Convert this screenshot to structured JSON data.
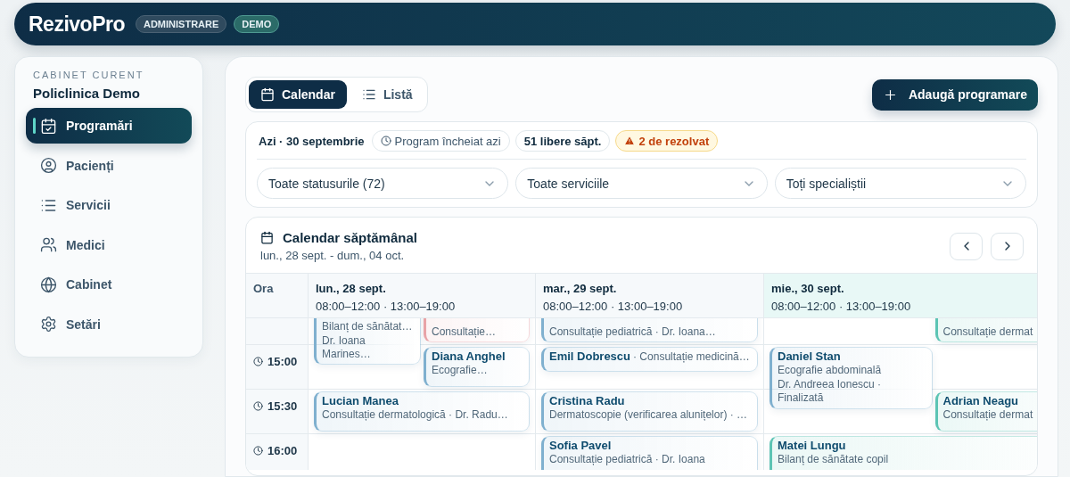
{
  "header": {
    "logo": "RezivoPro",
    "badges": [
      {
        "label": "ADMINISTRARE",
        "kind": "role"
      },
      {
        "label": "DEMO",
        "kind": "env"
      }
    ]
  },
  "sidebar": {
    "caption": "CABINET CURENT",
    "clinic": "Policlinica Demo",
    "items": [
      {
        "label": "Programări",
        "selected": true
      },
      {
        "label": "Pacienți",
        "selected": false
      },
      {
        "label": "Servicii",
        "selected": false
      },
      {
        "label": "Medici",
        "selected": false
      },
      {
        "label": "Cabinet",
        "selected": false
      },
      {
        "label": "Setări",
        "selected": false
      }
    ]
  },
  "view_toggle": [
    {
      "label": "Calendar",
      "selected": true
    },
    {
      "label": "Listă",
      "selected": false
    }
  ],
  "add_button": "Adaugă programare",
  "summary": {
    "today": "Azi · 30 septembrie",
    "chips": [
      {
        "label": "Program încheiat azi",
        "kind": "status"
      },
      {
        "label": "51 libere săpt.",
        "kind": "plain"
      },
      {
        "label": "2 de rezolvat",
        "kind": "warning"
      }
    ]
  },
  "filters": [
    {
      "value": "Toate statusurile (72)"
    },
    {
      "value": "Toate serviciile"
    },
    {
      "value": "Toți specialiștii"
    }
  ],
  "calendar": {
    "title": "Calendar săptămânal",
    "range": "lun., 28 sept. - dum., 04 oct.",
    "time_header": "Ora",
    "days": [
      {
        "label": "lun., 28 sept.",
        "hours": "08:00–12:00 · 13:00–19:00",
        "selected": false
      },
      {
        "label": "mar., 29 sept.",
        "hours": "08:00–12:00 · 13:00–19:00",
        "selected": false
      },
      {
        "label": "mie., 30 sept.",
        "hours": "08:00–12:00 · 13:00–19:00",
        "selected": true
      }
    ],
    "rows": [
      {
        "cells": [
          [
            {
              "kind": "left-long",
              "lines": [
                "Bilanț de sănătat…",
                "Dr. Ioana Marines…"
              ],
              "color": "#7fb0cf"
            },
            {
              "kind": "right",
              "lines": [
                "Consultație…"
              ],
              "color": "#e8a3a7"
            }
          ],
          [
            {
              "kind": "full",
              "lines": [
                "Consultație pediatrică · Dr. Ioana…"
              ],
              "color": "#7fb0cf"
            }
          ],
          [
            {
              "kind": "right",
              "lines": [
                "Consultație dermat"
              ],
              "color": "#5cc4b4"
            }
          ]
        ]
      },
      {
        "time": "15:00",
        "cells": [
          [
            {
              "kind": "right",
              "name": "Diana Anghel",
              "lines": [
                "Ecografie…"
              ],
              "color": "#7fb0cf"
            }
          ],
          [
            {
              "kind": "full-short",
              "name": "Emil Dobrescu",
              "inline": "· Consultație medicină…",
              "color": "#7fb0cf"
            }
          ],
          [
            {
              "kind": "left-long",
              "name": "Daniel Stan",
              "lines": [
                "Ecografie abdominală",
                "Dr. Andreea Ionescu · Finalizată"
              ],
              "color": "#7fb0cf"
            }
          ]
        ]
      },
      {
        "time": "15:30",
        "cells": [
          [
            {
              "kind": "full",
              "name": "Lucian Manea",
              "lines": [
                "Consultație dermatologică · Dr. Radu…"
              ],
              "color": "#7fb0cf"
            }
          ],
          [
            {
              "kind": "full",
              "name": "Cristina Radu",
              "lines": [
                "Dermatoscopie (verificarea alunițelor) · …"
              ],
              "color": "#7fb0cf"
            }
          ],
          [
            {
              "kind": "right",
              "name": "Adrian Neagu",
              "lines": [
                "Consultație dermat"
              ],
              "color": "#5cc4b4"
            }
          ]
        ]
      },
      {
        "time": "16:00",
        "cells": [
          [],
          [
            {
              "kind": "full-long",
              "name": "Sofia Pavel",
              "lines": [
                "Consultație pediatrică · Dr. Ioana"
              ],
              "color": "#7fb0cf"
            }
          ],
          [
            {
              "kind": "full-long",
              "name": "Matei Lungu",
              "lines": [
                "Bilanț de sănătate copil"
              ],
              "color": "#5cc4b4"
            }
          ]
        ]
      }
    ]
  }
}
